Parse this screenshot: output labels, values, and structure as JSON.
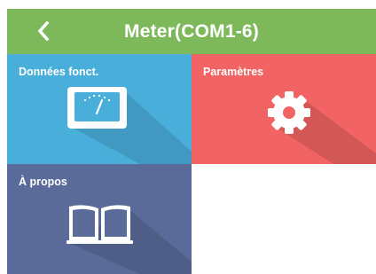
{
  "header": {
    "title": "Meter(COM1-6)",
    "back_icon": "chevron-left-icon",
    "color": "#7db85b"
  },
  "tiles": [
    {
      "label": "Données fonct.",
      "icon": "meter-gauge-icon",
      "color": "#4aaedb"
    },
    {
      "label": "Paramètres",
      "icon": "gear-icon",
      "color": "#f26463"
    },
    {
      "label": "À propos",
      "icon": "open-book-icon",
      "color": "#5b6b99"
    }
  ]
}
